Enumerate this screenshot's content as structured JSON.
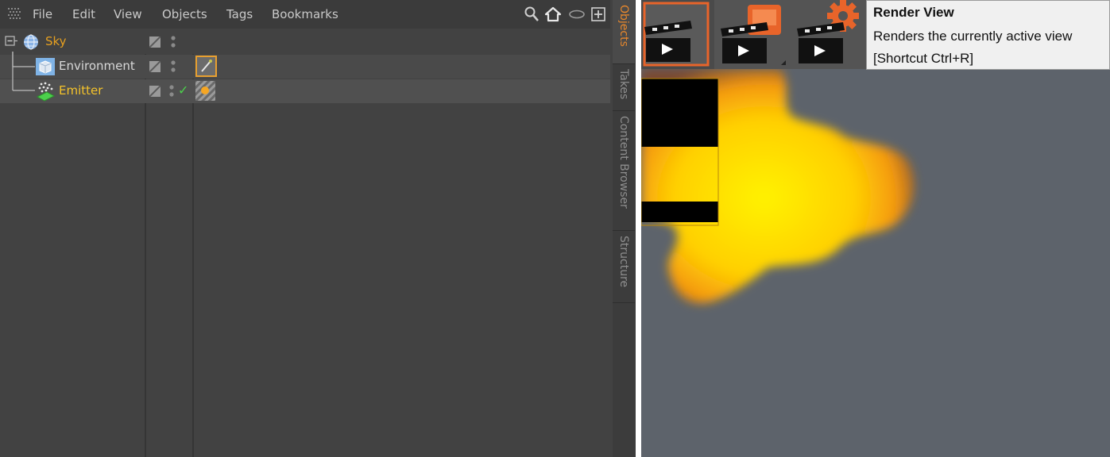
{
  "menu": {
    "items": [
      "File",
      "Edit",
      "View",
      "Objects",
      "Tags",
      "Bookmarks"
    ]
  },
  "toolbar_icons": [
    "search-icon",
    "home-icon",
    "view-icon",
    "maximize-icon"
  ],
  "objects": [
    {
      "name": "Sky",
      "color": "#e6a020",
      "icon": "sky-globe-icon",
      "tag": ""
    },
    {
      "name": "Environment",
      "color": "#d8d8d8",
      "icon": "environment-icon",
      "tag": "material-tag-icon"
    },
    {
      "name": "Emitter",
      "color": "#f5c32a",
      "icon": "emitter-icon",
      "tag": "particle-tag-icon",
      "enabled_check": "✓"
    }
  ],
  "side_tabs": [
    {
      "label": "Objects",
      "active": true
    },
    {
      "label": "Takes",
      "active": false
    },
    {
      "label": "Content Browser",
      "active": false
    },
    {
      "label": "Structure",
      "active": false
    }
  ],
  "render_toolbar": {
    "buttons": [
      "render-view-button",
      "render-to-picture-viewer-button",
      "render-settings-button"
    ]
  },
  "tooltip": {
    "title": "Render View",
    "description": "Renders the currently active view",
    "shortcut": "[Shortcut Ctrl+R]"
  },
  "colors": {
    "accent": "#e6872c",
    "panel_bg": "#424242",
    "viewport_bg": "#5d636b"
  }
}
